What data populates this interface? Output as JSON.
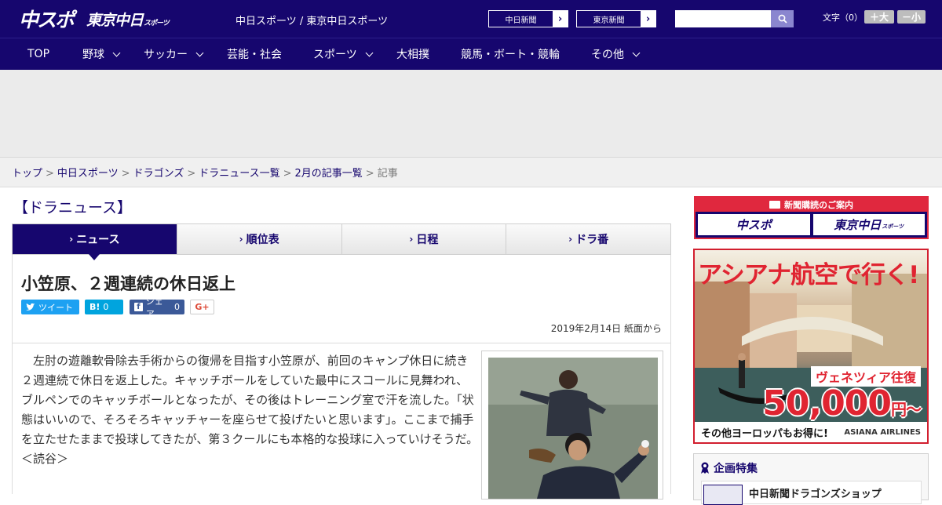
{
  "header": {
    "logo_chuspo": "中スポ",
    "logo_tokyo": "東京中日",
    "logo_tokyo_small": "スポーツ",
    "site_links": "中日スポーツ / 東京中日スポーツ",
    "paper_btn_1": "中日新聞",
    "paper_btn_2": "東京新聞",
    "arrow": "›",
    "search_placeholder": "",
    "font_size_label": "文字（0）",
    "font_big": "＋大",
    "font_small": "－小"
  },
  "nav": [
    "TOP",
    "野球",
    "サッカー",
    "芸能・社会",
    "スポーツ",
    "大相撲",
    "競馬・ボート・競輪",
    "その他"
  ],
  "breadcrumb": {
    "items": [
      "トップ",
      "中日スポーツ",
      "ドラゴンズ",
      "ドラニュース一覧",
      "2月の記事一覧"
    ],
    "current": "記事",
    "separator": ">"
  },
  "section_title": "【ドラニュース】",
  "tabs": [
    "ニュース",
    "順位表",
    "日程",
    "ドラ番"
  ],
  "tab_marker": "›",
  "article": {
    "headline": "小笠原、２週連続の休日返上",
    "share": {
      "tweet": "ツイート",
      "hatena_label": "B!",
      "hatena_count": "0",
      "fb_label": "シェア",
      "fb_count": "0",
      "gplus": "G+"
    },
    "date": "2019年2月14日 紙面から",
    "body": "左肘の遊離軟骨除去手術からの復帰を目指す小笠原が、前回のキャンプ休日に続き２週連続で休日を返上した。キャッチボールをしていた最中にスコールに見舞われ、ブルペンでのキャッチボールとなったが、その後はトレーニング室で汗を流した。「状態はいいので、そろそろキャッチャーを座らせて投げたいと思います」。ここまで捕手を立たせたままで投球してきたが、第３クールにも本格的な投球に入っていけそうだ。　＜読谷＞"
  },
  "sidebar": {
    "subscription_head": "新聞購読のご案内",
    "sub_btn_1": "中スポ",
    "sub_btn_2": "東京中日",
    "sub_btn_2_small": "スポーツ",
    "ad_title": "アシアナ航空で行く!",
    "ad_venice": "ヴェネツィア往復",
    "ad_price": "50,000",
    "ad_price_unit": "円～",
    "ad_bottom_text": "その他ヨーロッパもお得に!",
    "ad_brand": "ASIANA AIRLINES",
    "feature_head": "企画特集",
    "feature_item": "中日新聞ドラゴンズショップ"
  },
  "colors": {
    "brand_navy": "#16066e",
    "accent_red": "#e0283e",
    "twitter": "#1da1f2",
    "hatena": "#00a4de",
    "facebook": "#3b5998"
  }
}
